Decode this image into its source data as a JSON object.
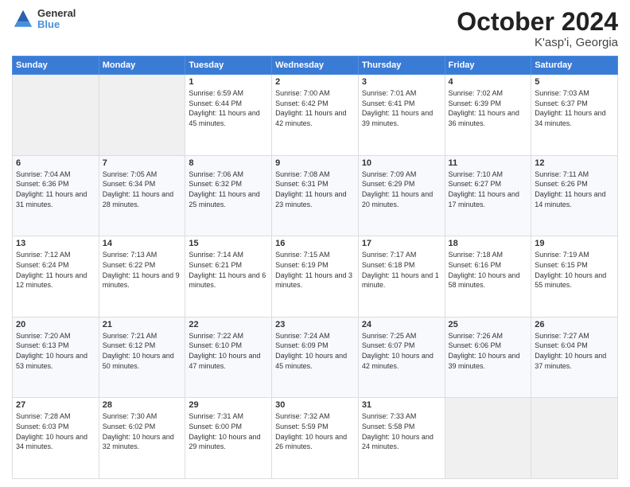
{
  "header": {
    "logo_text_1": "General",
    "logo_text_2": "Blue",
    "title": "October 2024",
    "subtitle": "K'asp'i, Georgia"
  },
  "weekdays": [
    "Sunday",
    "Monday",
    "Tuesday",
    "Wednesday",
    "Thursday",
    "Friday",
    "Saturday"
  ],
  "weeks": [
    [
      {
        "day": "",
        "info": ""
      },
      {
        "day": "",
        "info": ""
      },
      {
        "day": "1",
        "info": "Sunrise: 6:59 AM\nSunset: 6:44 PM\nDaylight: 11 hours and 45 minutes."
      },
      {
        "day": "2",
        "info": "Sunrise: 7:00 AM\nSunset: 6:42 PM\nDaylight: 11 hours and 42 minutes."
      },
      {
        "day": "3",
        "info": "Sunrise: 7:01 AM\nSunset: 6:41 PM\nDaylight: 11 hours and 39 minutes."
      },
      {
        "day": "4",
        "info": "Sunrise: 7:02 AM\nSunset: 6:39 PM\nDaylight: 11 hours and 36 minutes."
      },
      {
        "day": "5",
        "info": "Sunrise: 7:03 AM\nSunset: 6:37 PM\nDaylight: 11 hours and 34 minutes."
      }
    ],
    [
      {
        "day": "6",
        "info": "Sunrise: 7:04 AM\nSunset: 6:36 PM\nDaylight: 11 hours and 31 minutes."
      },
      {
        "day": "7",
        "info": "Sunrise: 7:05 AM\nSunset: 6:34 PM\nDaylight: 11 hours and 28 minutes."
      },
      {
        "day": "8",
        "info": "Sunrise: 7:06 AM\nSunset: 6:32 PM\nDaylight: 11 hours and 25 minutes."
      },
      {
        "day": "9",
        "info": "Sunrise: 7:08 AM\nSunset: 6:31 PM\nDaylight: 11 hours and 23 minutes."
      },
      {
        "day": "10",
        "info": "Sunrise: 7:09 AM\nSunset: 6:29 PM\nDaylight: 11 hours and 20 minutes."
      },
      {
        "day": "11",
        "info": "Sunrise: 7:10 AM\nSunset: 6:27 PM\nDaylight: 11 hours and 17 minutes."
      },
      {
        "day": "12",
        "info": "Sunrise: 7:11 AM\nSunset: 6:26 PM\nDaylight: 11 hours and 14 minutes."
      }
    ],
    [
      {
        "day": "13",
        "info": "Sunrise: 7:12 AM\nSunset: 6:24 PM\nDaylight: 11 hours and 12 minutes."
      },
      {
        "day": "14",
        "info": "Sunrise: 7:13 AM\nSunset: 6:22 PM\nDaylight: 11 hours and 9 minutes."
      },
      {
        "day": "15",
        "info": "Sunrise: 7:14 AM\nSunset: 6:21 PM\nDaylight: 11 hours and 6 minutes."
      },
      {
        "day": "16",
        "info": "Sunrise: 7:15 AM\nSunset: 6:19 PM\nDaylight: 11 hours and 3 minutes."
      },
      {
        "day": "17",
        "info": "Sunrise: 7:17 AM\nSunset: 6:18 PM\nDaylight: 11 hours and 1 minute."
      },
      {
        "day": "18",
        "info": "Sunrise: 7:18 AM\nSunset: 6:16 PM\nDaylight: 10 hours and 58 minutes."
      },
      {
        "day": "19",
        "info": "Sunrise: 7:19 AM\nSunset: 6:15 PM\nDaylight: 10 hours and 55 minutes."
      }
    ],
    [
      {
        "day": "20",
        "info": "Sunrise: 7:20 AM\nSunset: 6:13 PM\nDaylight: 10 hours and 53 minutes."
      },
      {
        "day": "21",
        "info": "Sunrise: 7:21 AM\nSunset: 6:12 PM\nDaylight: 10 hours and 50 minutes."
      },
      {
        "day": "22",
        "info": "Sunrise: 7:22 AM\nSunset: 6:10 PM\nDaylight: 10 hours and 47 minutes."
      },
      {
        "day": "23",
        "info": "Sunrise: 7:24 AM\nSunset: 6:09 PM\nDaylight: 10 hours and 45 minutes."
      },
      {
        "day": "24",
        "info": "Sunrise: 7:25 AM\nSunset: 6:07 PM\nDaylight: 10 hours and 42 minutes."
      },
      {
        "day": "25",
        "info": "Sunrise: 7:26 AM\nSunset: 6:06 PM\nDaylight: 10 hours and 39 minutes."
      },
      {
        "day": "26",
        "info": "Sunrise: 7:27 AM\nSunset: 6:04 PM\nDaylight: 10 hours and 37 minutes."
      }
    ],
    [
      {
        "day": "27",
        "info": "Sunrise: 7:28 AM\nSunset: 6:03 PM\nDaylight: 10 hours and 34 minutes."
      },
      {
        "day": "28",
        "info": "Sunrise: 7:30 AM\nSunset: 6:02 PM\nDaylight: 10 hours and 32 minutes."
      },
      {
        "day": "29",
        "info": "Sunrise: 7:31 AM\nSunset: 6:00 PM\nDaylight: 10 hours and 29 minutes."
      },
      {
        "day": "30",
        "info": "Sunrise: 7:32 AM\nSunset: 5:59 PM\nDaylight: 10 hours and 26 minutes."
      },
      {
        "day": "31",
        "info": "Sunrise: 7:33 AM\nSunset: 5:58 PM\nDaylight: 10 hours and 24 minutes."
      },
      {
        "day": "",
        "info": ""
      },
      {
        "day": "",
        "info": ""
      }
    ]
  ]
}
